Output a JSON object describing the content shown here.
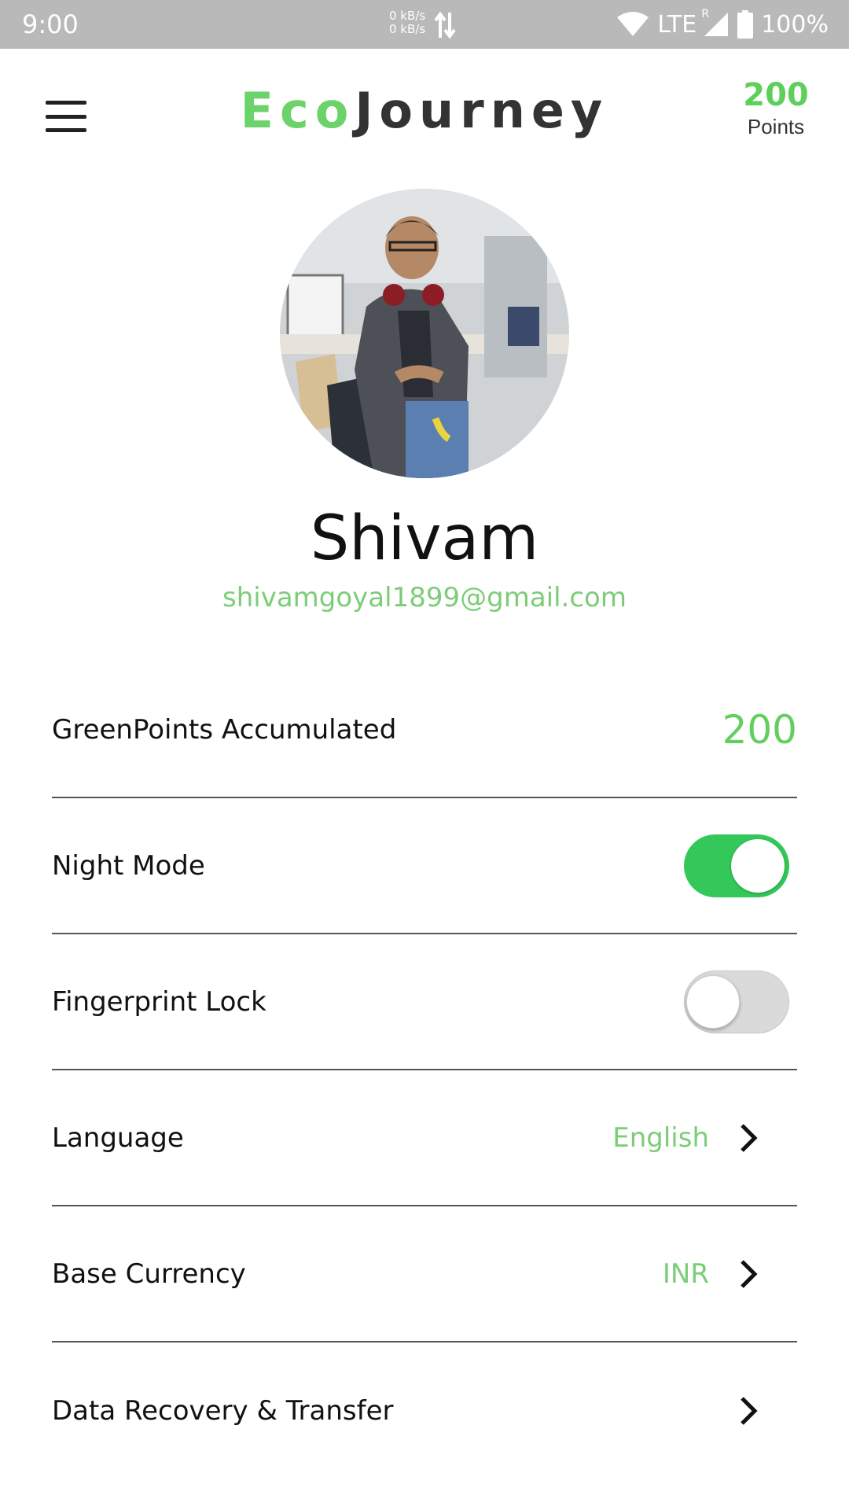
{
  "status_bar": {
    "time": "9:00",
    "net_up": "0 kB/s",
    "net_down": "0 kB/s",
    "network": "LTE",
    "roaming": "R",
    "battery": "100%"
  },
  "header": {
    "title_part1": "Eco",
    "title_part2": "Journey",
    "points_value": "200",
    "points_label": "Points",
    "menu_icon": "hamburger-menu-icon"
  },
  "profile": {
    "name": "Shivam",
    "email": "shivamgoyal1899@gmail.com"
  },
  "settings": {
    "greenpoints": {
      "label": "GreenPoints Accumulated",
      "value": "200"
    },
    "night_mode": {
      "label": "Night Mode",
      "enabled": true
    },
    "fingerprint": {
      "label": "Fingerprint Lock",
      "enabled": false
    },
    "language": {
      "label": "Language",
      "value": "English"
    },
    "currency": {
      "label": "Base Currency",
      "value": "INR"
    },
    "data_recovery": {
      "label": "Data Recovery & Transfer"
    }
  },
  "colors": {
    "accent_green": "#5fcf5b",
    "toggle_on": "#34c759",
    "status_bar": "#b9b9b9"
  }
}
